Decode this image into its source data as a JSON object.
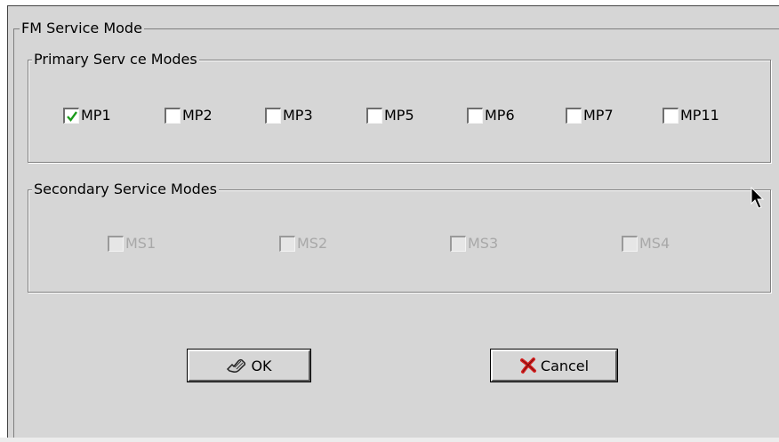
{
  "dialog": {
    "group_title": "FM Service Mode",
    "primary": {
      "title": "Primary Serv ce Modes",
      "modes": [
        {
          "label": "MP1",
          "checked": true
        },
        {
          "label": "MP2",
          "checked": false
        },
        {
          "label": "MP3",
          "checked": false
        },
        {
          "label": "MP5",
          "checked": false
        },
        {
          "label": "MP6",
          "checked": false
        },
        {
          "label": "MP7",
          "checked": false
        },
        {
          "label": "MP11",
          "checked": false
        }
      ]
    },
    "secondary": {
      "title": "Secondary Service Modes",
      "modes": [
        {
          "label": "MS1",
          "checked": false,
          "enabled": false
        },
        {
          "label": "MS2",
          "checked": false,
          "enabled": false
        },
        {
          "label": "MS3",
          "checked": false,
          "enabled": false
        },
        {
          "label": "MS4",
          "checked": false,
          "enabled": false
        }
      ]
    },
    "buttons": {
      "ok": {
        "label": "OK",
        "icon": "ok-hand-icon"
      },
      "cancel": {
        "label": "Cancel",
        "icon": "red-x-icon"
      }
    }
  },
  "colors": {
    "panel": "#d6d6d6",
    "check_mark": "#1a9a1a",
    "cancel_x": "#d42020",
    "disabled_text": "#a8a8a8"
  }
}
